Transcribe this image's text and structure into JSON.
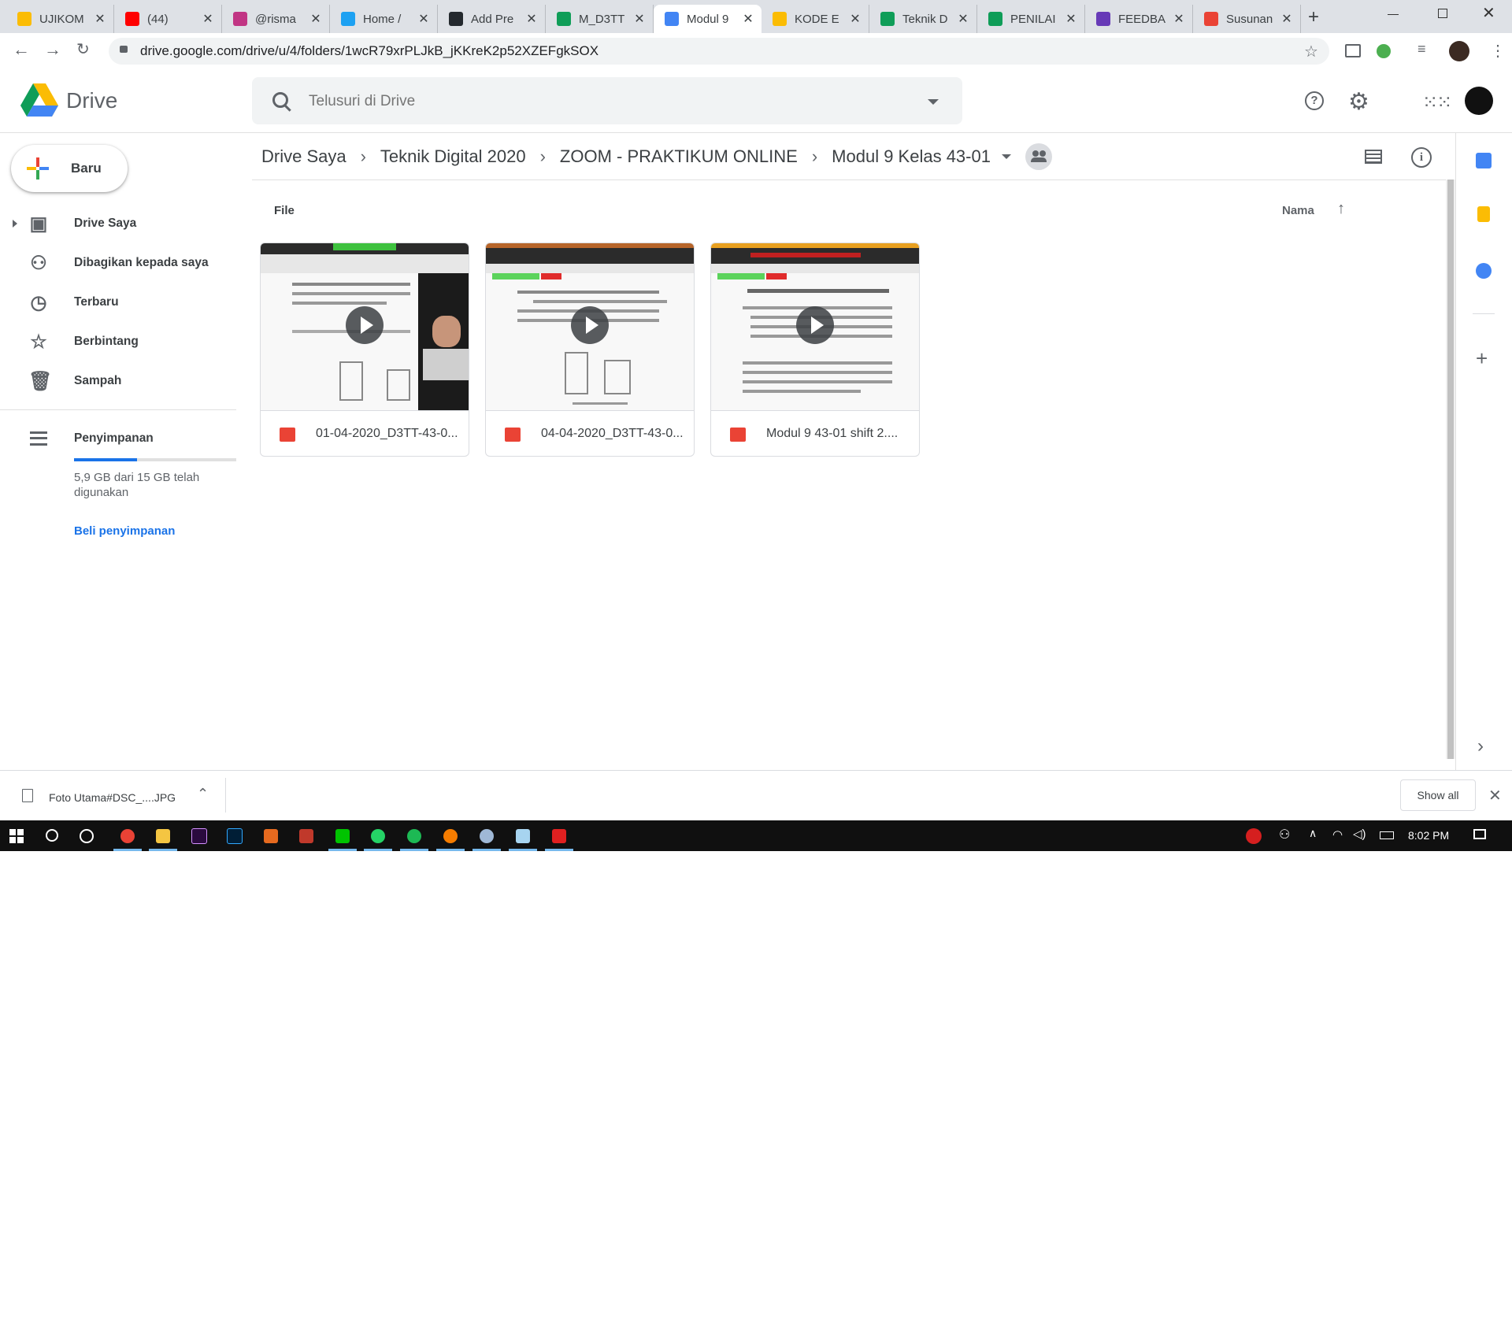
{
  "browser": {
    "tabs": [
      {
        "title": "UJIKOM",
        "icon": "google-drive-icon",
        "color": "#fbbc04"
      },
      {
        "title": "(44)",
        "icon": "youtube-icon",
        "color": "#ff0000"
      },
      {
        "title": "@risma",
        "icon": "instagram-icon",
        "color": "#c13584"
      },
      {
        "title": "Home /",
        "icon": "twitter-icon",
        "color": "#1da1f2"
      },
      {
        "title": "Add Pre",
        "icon": "github-icon",
        "color": "#24292e"
      },
      {
        "title": "M_D3TT",
        "icon": "google-drive-icon",
        "color": "#0f9d58"
      },
      {
        "title": "Modul 9",
        "icon": "google-drive-icon",
        "color": "#4285f4"
      },
      {
        "title": "KODE E",
        "icon": "google-drive-icon",
        "color": "#fbbc04"
      },
      {
        "title": "Teknik D",
        "icon": "google-drive-icon",
        "color": "#0f9d58"
      },
      {
        "title": "PENILAI",
        "icon": "google-sheets-icon",
        "color": "#0f9d58"
      },
      {
        "title": "FEEDBA",
        "icon": "google-forms-icon",
        "color": "#673ab7"
      },
      {
        "title": "Susunan",
        "icon": "video-file-icon",
        "color": "#ea4335"
      }
    ],
    "new_tab_label": "+",
    "url": "drive.google.com/drive/u/4/folders/1wcR79xrPLJkB_jKKreK2p52XZEFgkSOX"
  },
  "drive": {
    "logo_text": "Drive",
    "search_placeholder": "Telusuri di Drive",
    "new_button": "Baru",
    "nav": [
      {
        "label": "Drive Saya",
        "icon": "my-drive-icon"
      },
      {
        "label": "Dibagikan kepada saya",
        "icon": "shared-with-me-icon"
      },
      {
        "label": "Terbaru",
        "icon": "clock-icon"
      },
      {
        "label": "Berbintang",
        "icon": "star-icon"
      },
      {
        "label": "Sampah",
        "icon": "trash-icon"
      }
    ],
    "storage": {
      "label": "Penyimpanan",
      "usage_text": "5,9 GB dari 15 GB telah digunakan",
      "used_fraction": 0.39,
      "buy_link": "Beli penyimpanan"
    },
    "breadcrumb": [
      "Drive Saya",
      "Teknik Digital 2020",
      "ZOOM - PRAKTIKUM ONLINE",
      "Modul 9 Kelas 43-01"
    ],
    "section_label": "File",
    "sort_label": "Nama",
    "files": [
      {
        "name": "01-04-2020_D3TT-43-0..."
      },
      {
        "name": "04-04-2020_D3TT-43-0..."
      },
      {
        "name": "Modul 9 43-01 shift 2...."
      }
    ],
    "accent": "#1a73e8"
  },
  "downloads": {
    "file": "Foto Utama#DSC_....JPG",
    "show_all": "Show all"
  },
  "taskbar": {
    "clock": "8:02 PM"
  }
}
